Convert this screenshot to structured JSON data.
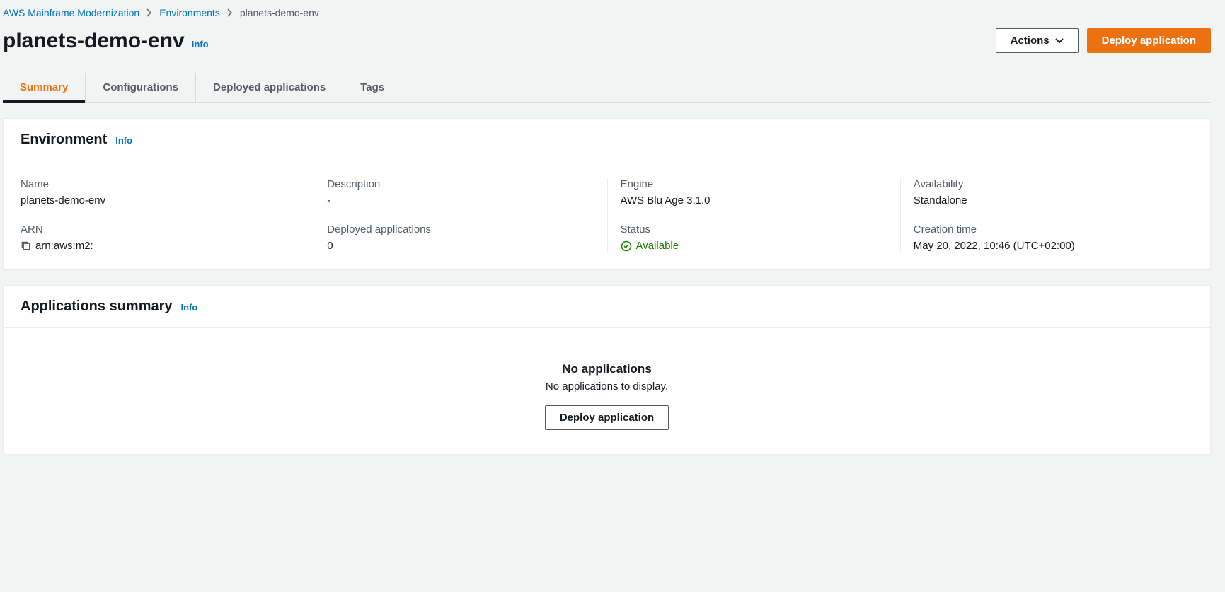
{
  "breadcrumb": {
    "root": "AWS Mainframe Modernization",
    "env": "Environments",
    "current": "planets-demo-env"
  },
  "header": {
    "title": "planets-demo-env",
    "info": "Info",
    "actions_label": "Actions",
    "deploy_label": "Deploy application"
  },
  "tabs": {
    "summary": "Summary",
    "configurations": "Configurations",
    "deployed": "Deployed applications",
    "tags": "Tags"
  },
  "environment_panel": {
    "title": "Environment",
    "info": "Info",
    "name_label": "Name",
    "name_value": "planets-demo-env",
    "arn_label": "ARN",
    "arn_value": "arn:aws:m2:",
    "description_label": "Description",
    "description_value": "-",
    "deployed_apps_label": "Deployed applications",
    "deployed_apps_value": "0",
    "engine_label": "Engine",
    "engine_value": "AWS Blu Age 3.1.0",
    "status_label": "Status",
    "status_value": "Available",
    "availability_label": "Availability",
    "availability_value": "Standalone",
    "creation_label": "Creation time",
    "creation_value": "May 20, 2022, 10:46 (UTC+02:00)"
  },
  "apps_panel": {
    "title": "Applications summary",
    "info": "Info",
    "empty_title": "No applications",
    "empty_sub": "No applications to display.",
    "deploy_label": "Deploy application"
  }
}
